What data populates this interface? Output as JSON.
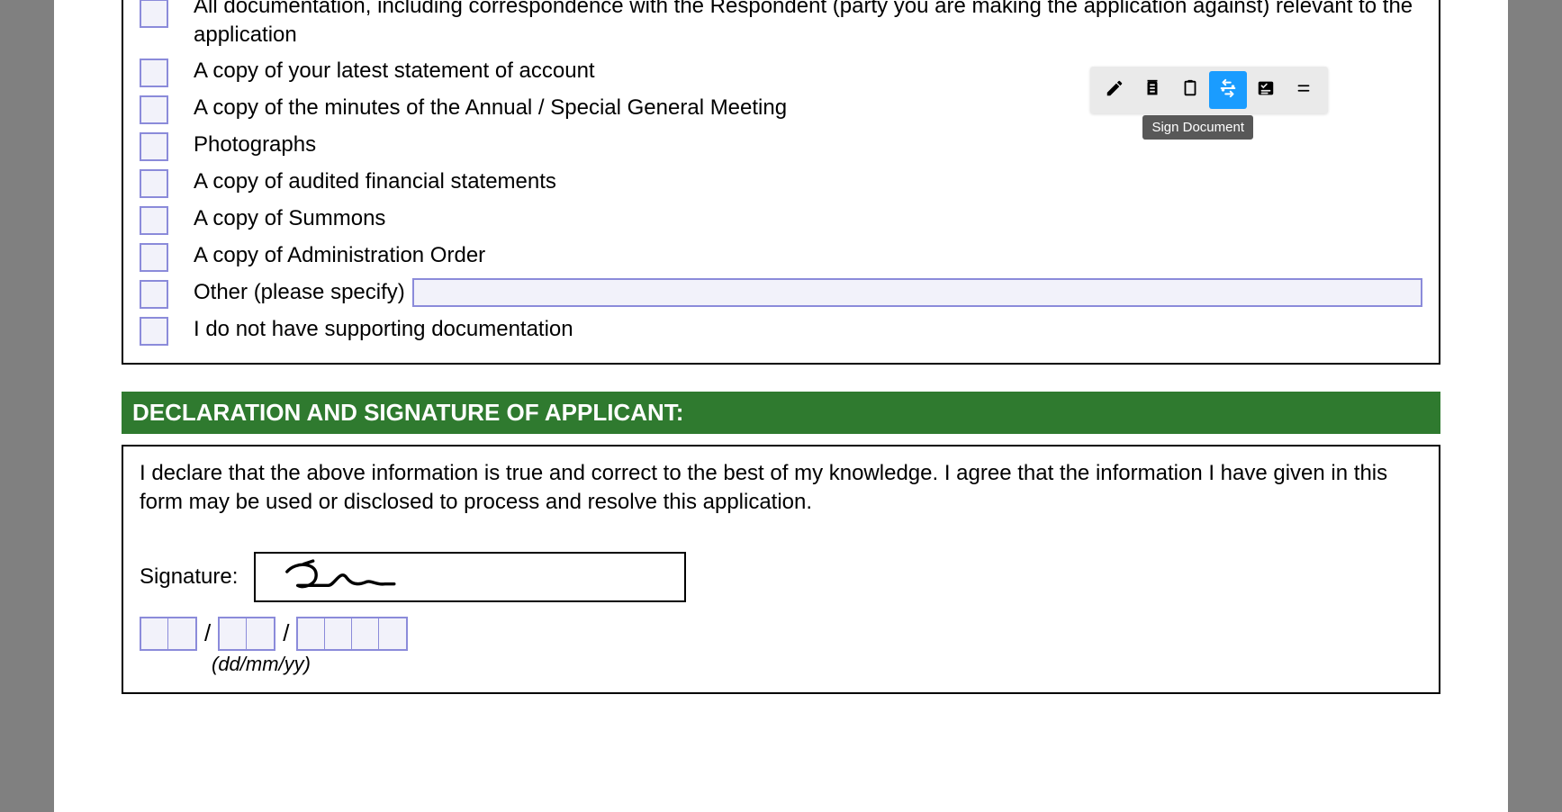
{
  "checklist": {
    "items": [
      {
        "label": "All documentation, including correspondence with the Respondent (party you are making the application against) relevant to the application"
      },
      {
        "label": "A copy of your latest statement of account"
      },
      {
        "label": "A copy of the minutes of the Annual / Special General Meeting"
      },
      {
        "label": "Photographs"
      },
      {
        "label": "A copy of audited financial statements"
      },
      {
        "label": "A copy of Summons"
      },
      {
        "label": "A copy of Administration Order"
      },
      {
        "label": "Other (please specify)",
        "hasInput": true,
        "inputValue": ""
      },
      {
        "label": "I do not have supporting documentation"
      }
    ]
  },
  "declaration": {
    "header": "DECLARATION AND SIGNATURE OF APPLICANT:",
    "text": "I declare that the above information is true and correct to the best of my knowledge. I agree that the information I have given in this form may be used or disclosed to process and resolve this application.",
    "signatureLabel": "Signature:",
    "dateFormatHint": "(dd/mm/yy)",
    "dateSlash": "/"
  },
  "toolbar": {
    "tooltip": "Sign Document",
    "buttons": [
      {
        "name": "pencil-icon",
        "label": "Edit"
      },
      {
        "name": "document-icon",
        "label": "Document"
      },
      {
        "name": "clipboard-icon",
        "label": "Clipboard"
      },
      {
        "name": "sign-icon",
        "label": "Sign",
        "active": true
      },
      {
        "name": "checklist-icon",
        "label": "Checklist"
      },
      {
        "name": "menu-icon",
        "label": "Menu"
      }
    ]
  }
}
